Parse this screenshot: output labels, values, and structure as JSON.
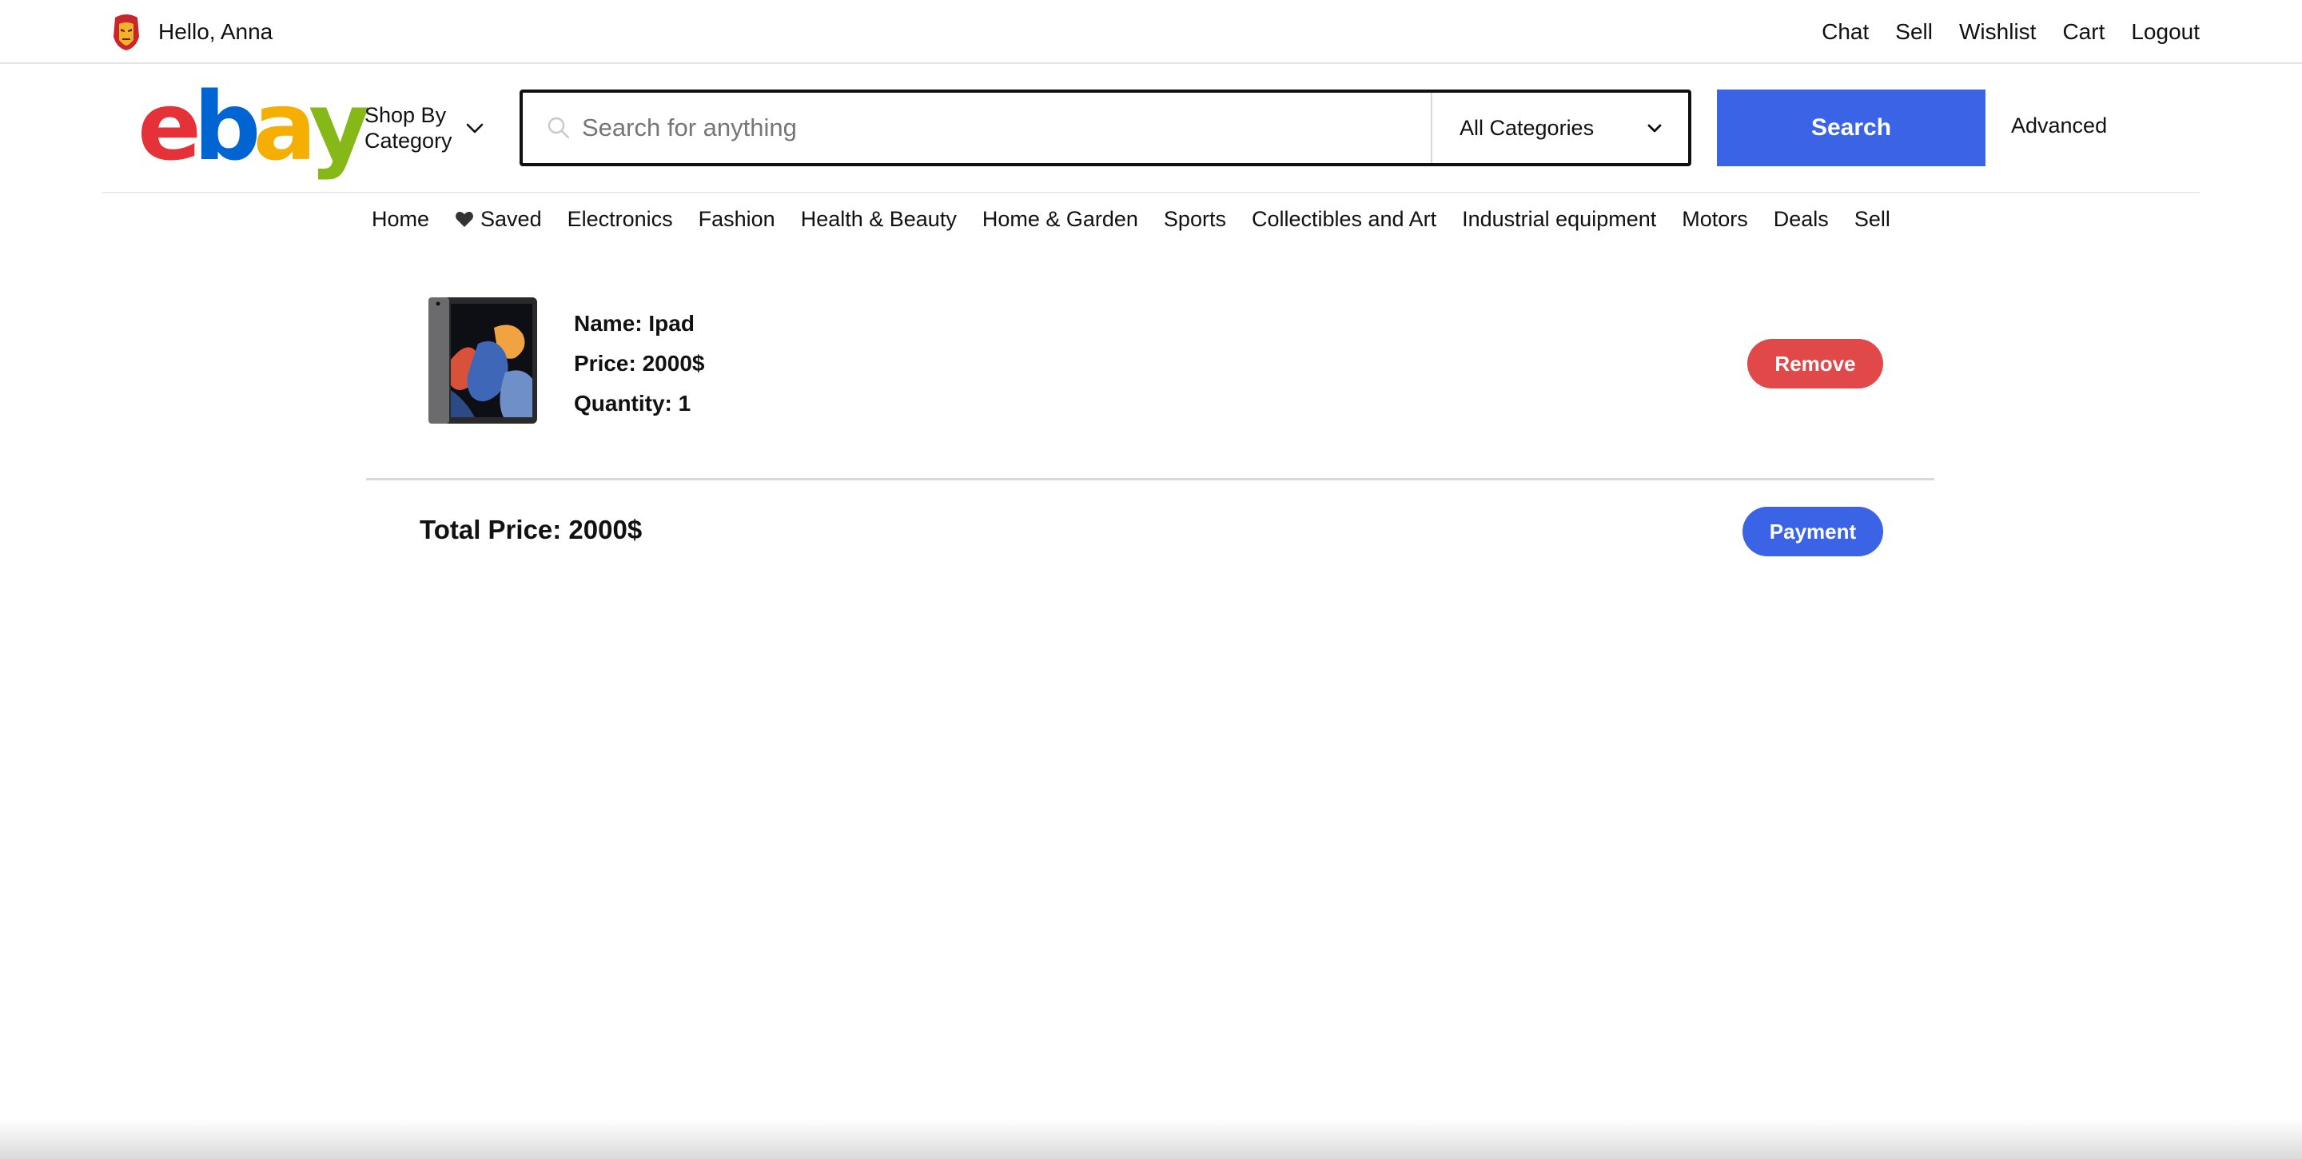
{
  "topbar": {
    "greeting": "Hello, Anna",
    "avatar_icon": "iron-man-mask-icon",
    "links": [
      "Chat",
      "Sell",
      "Wishlist",
      "Cart",
      "Logout"
    ]
  },
  "header": {
    "logo_letters": [
      "e",
      "b",
      "a",
      "y"
    ],
    "logo_colors": [
      "#e53238",
      "#0064d2",
      "#f5af02",
      "#86b817"
    ],
    "shop_by_line1": "Shop By",
    "shop_by_line2": "Category",
    "search_placeholder": "Search for anything",
    "search_value": "",
    "category_selected": "All Categories",
    "search_button": "Search",
    "advanced_link": "Advanced"
  },
  "nav": {
    "items": [
      "Home",
      "Saved",
      "Electronics",
      "Fashion",
      "Health & Beauty",
      "Home & Garden",
      "Sports",
      "Collectibles and Art",
      "Industrial equipment",
      "Motors",
      "Deals",
      "Sell"
    ]
  },
  "cart": {
    "items": [
      {
        "name": "Name: Ipad",
        "price": "Price: 2000$",
        "quantity": "Quantity: 1",
        "remove_label": "Remove"
      }
    ],
    "total": "Total Price: 2000$",
    "payment_label": "Payment"
  },
  "colors": {
    "accent_blue": "#3b63e6",
    "remove_red": "#e0484a"
  }
}
